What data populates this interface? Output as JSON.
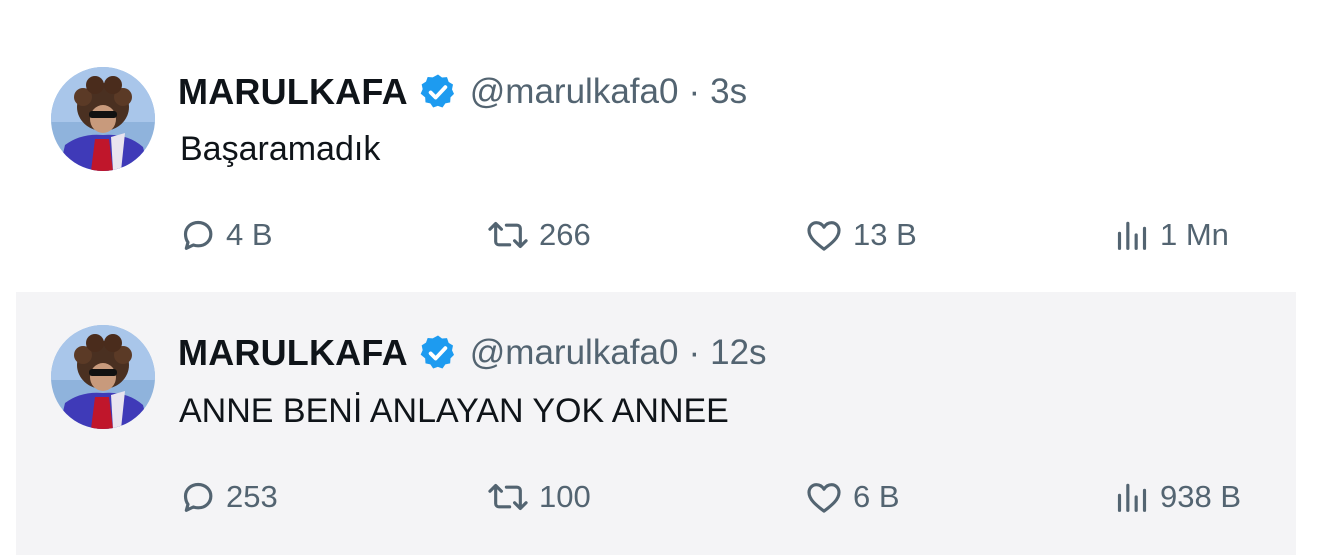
{
  "colors": {
    "verified": "#1d9bf0",
    "secondary_text": "#536471",
    "primary_text": "#0f1419",
    "highlight_bg": "#f4f4f6"
  },
  "icons": {
    "reply": "speech-bubble-icon",
    "retweet": "retweet-arrows-icon",
    "like": "heart-icon",
    "views": "bar-chart-icon",
    "verified": "verified-badge-icon"
  },
  "tweets": [
    {
      "name": "MARULKAFA",
      "handle": "@marulkafa0",
      "separator": "·",
      "time": "3s",
      "text": "Başaramadık",
      "replies": "4 B",
      "retweets": "266",
      "likes": "13 B",
      "views": "1 Mn"
    },
    {
      "name": "MARULKAFA",
      "handle": "@marulkafa0",
      "separator": "·",
      "time": "12s",
      "text": "ANNE BENİ ANLAYAN YOK ANNEE",
      "replies": "253",
      "retweets": "100",
      "likes": "6 B",
      "views": "938 B"
    }
  ]
}
